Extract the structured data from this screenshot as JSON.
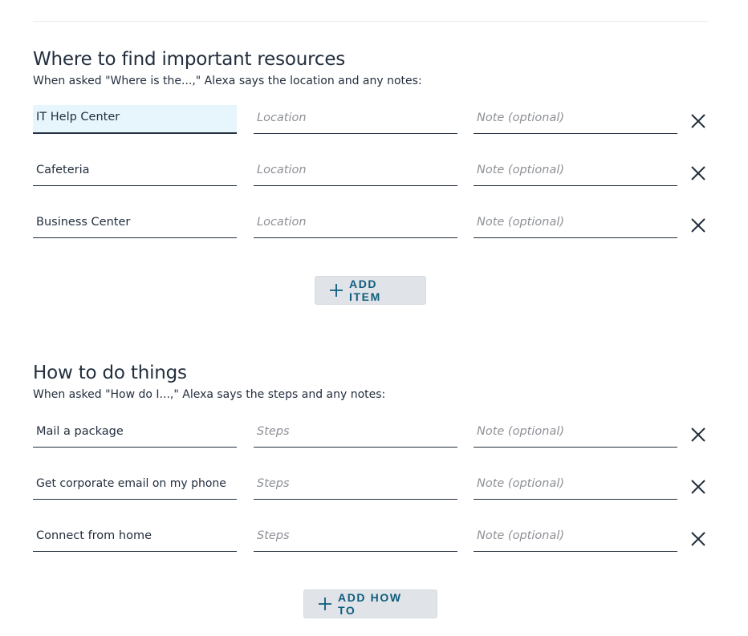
{
  "resources": {
    "title": "Where to find important resources",
    "description": "When asked \"Where is the...,\" Alexa says the location and any notes:",
    "location_placeholder": "Location",
    "note_placeholder": "Note (optional)",
    "items": [
      {
        "name": "IT Help Center"
      },
      {
        "name": "Cafeteria"
      },
      {
        "name": "Business Center"
      }
    ],
    "add_label": "ADD ITEM"
  },
  "howto": {
    "title": "How to do things",
    "description": "When asked \"How do I...,\" Alexa says the steps and any notes:",
    "steps_placeholder": "Steps",
    "note_placeholder": "Note (optional)",
    "items": [
      {
        "name": "Mail a package"
      },
      {
        "name": "Get corporate email on my phone"
      },
      {
        "name": "Connect from home"
      }
    ],
    "add_label": "ADD HOW TO"
  },
  "colors": {
    "text": "#232f3e",
    "placeholder": "#8d9096",
    "active_field_bg": "#e6f6fc",
    "button_bg": "#e0e4e8",
    "button_text": "#0f5d7d"
  },
  "icons": {
    "remove": "close-icon",
    "add": "plus-icon"
  }
}
